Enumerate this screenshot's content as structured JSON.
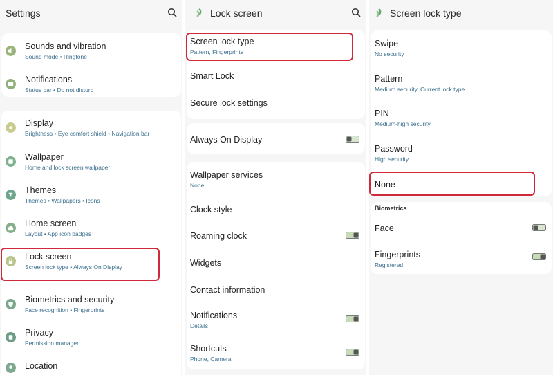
{
  "colors": {
    "highlight": "#d02a3a",
    "subtext": "#3b6f8e",
    "background": "#f6f6f6"
  },
  "settings": {
    "title": "Settings",
    "items": [
      {
        "label": "Sounds and vibration",
        "sub": "Sound mode  •  Ringtone",
        "icon": "speaker-icon",
        "color": "#9ab57a"
      },
      {
        "label": "Notifications",
        "sub": "Status bar  •  Do not disturb",
        "icon": "notification-icon",
        "color": "#8fb27a"
      },
      {
        "label": "Display",
        "sub": "Brightness  •  Eye comfort shield  •  Navigation bar",
        "icon": "sun-icon",
        "color": "#c9cc8f"
      },
      {
        "label": "Wallpaper",
        "sub": "Home and lock screen wallpaper",
        "icon": "image-icon",
        "color": "#7fb08f"
      },
      {
        "label": "Themes",
        "sub": "Themes  •  Wallpapers  •  Icons",
        "icon": "brush-icon",
        "color": "#6ea58c"
      },
      {
        "label": "Home screen",
        "sub": "Layout  •  App icon badges",
        "icon": "home-icon",
        "color": "#86b08a"
      },
      {
        "label": "Lock screen",
        "sub": "Screen lock type  •  Always On Display",
        "icon": "lock-icon",
        "color": "#b8c48a"
      },
      {
        "label": "Biometrics and security",
        "sub": "Face recognition  •  Fingerprints",
        "icon": "shield-icon",
        "color": "#7aa98a"
      },
      {
        "label": "Privacy",
        "sub": "Permission manager",
        "icon": "privacy-icon",
        "color": "#6e9c86"
      },
      {
        "label": "Location",
        "sub": "",
        "icon": "location-icon",
        "color": "#7fa98e"
      }
    ]
  },
  "lock_screen": {
    "title": "Lock screen",
    "items": [
      {
        "label": "Screen lock type",
        "sub": "Pattern, Fingerprints"
      },
      {
        "label": "Smart Lock",
        "sub": ""
      },
      {
        "label": "Secure lock settings",
        "sub": ""
      },
      {
        "label": "Always On Display",
        "sub": "",
        "toggle": true
      },
      {
        "label": "Wallpaper services",
        "sub": "None"
      },
      {
        "label": "Clock style",
        "sub": ""
      },
      {
        "label": "Roaming clock",
        "sub": "",
        "toggle": true
      },
      {
        "label": "Widgets",
        "sub": ""
      },
      {
        "label": "Contact information",
        "sub": ""
      },
      {
        "label": "Notifications",
        "sub": "Details",
        "toggle": true
      },
      {
        "label": "Shortcuts",
        "sub": "Phone, Camera",
        "toggle": true
      }
    ]
  },
  "screen_lock_type": {
    "title": "Screen lock type",
    "items": [
      {
        "label": "Swipe",
        "sub": "No security"
      },
      {
        "label": "Pattern",
        "sub": "Medium security, Current lock type"
      },
      {
        "label": "PIN",
        "sub": "Medium-high security"
      },
      {
        "label": "Password",
        "sub": "High security"
      },
      {
        "label": "None",
        "sub": ""
      }
    ],
    "section": "Biometrics",
    "bio_items": [
      {
        "label": "Face",
        "sub": "",
        "toggle": true
      },
      {
        "label": "Fingerprints",
        "sub": "Registered",
        "toggle": true
      }
    ]
  }
}
